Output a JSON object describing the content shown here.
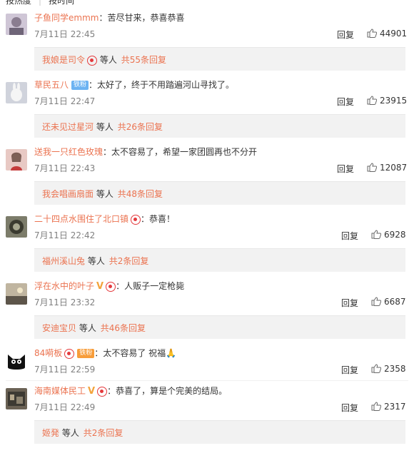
{
  "sort": {
    "hot": "按热度",
    "time": "按时间"
  },
  "comments": [
    {
      "user": "子鱼同学emmm",
      "text": "苦尽甘来，恭喜恭喜",
      "time": "7月11日 22:45",
      "likes": "44901",
      "reply_user": "我娘是司令",
      "etc": "等人",
      "reply_count": "共55条回复"
    },
    {
      "user": "草民五八",
      "fan_badge": "铁粉",
      "text": "太好了，终于不用踏遍河山寻找了。",
      "time": "7月11日 22:47",
      "likes": "23915",
      "reply_user": "还未见过星河",
      "etc": "等人",
      "reply_count": "共26条回复"
    },
    {
      "user": "送我一只红色玫瑰",
      "text": "太不容易了，希望一家团圆再也不分开",
      "time": "7月11日 22:43",
      "likes": "12087",
      "reply_user": "我会唱画扇面",
      "etc": "等人",
      "reply_count": "共48条回复"
    },
    {
      "user": "二十四点水围住了北口镇",
      "text": "恭喜！",
      "time": "7月11日 22:42",
      "likes": "6928",
      "reply_user": "福州溪山兔",
      "etc": "等人",
      "reply_count": "共2条回复"
    },
    {
      "user": "浮在水中的叶子",
      "text": "人贩子一定枪毙",
      "time": "7月11日 23:32",
      "likes": "6687",
      "reply_user": "安迪宝贝",
      "etc": "等人",
      "reply_count": "共46条回复"
    },
    {
      "user": "84嗬板",
      "fan_badge": "铁粉",
      "text": "太不容易了 祝福🙏",
      "time": "7月11日 22:59",
      "likes": "2358"
    },
    {
      "user": "海南媒体民工",
      "text": "恭喜了，算是个完美的结局。",
      "time": "7月11日 22:49",
      "likes": "2317",
      "reply_user": "姬発",
      "etc": "等人",
      "reply_count": "共2条回复"
    }
  ],
  "labels": {
    "reply": "回复",
    "colon": "："
  }
}
